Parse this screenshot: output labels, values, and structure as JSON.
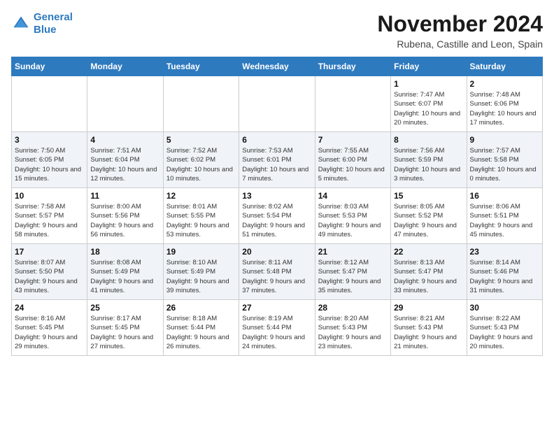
{
  "header": {
    "logo_line1": "General",
    "logo_line2": "Blue",
    "month": "November 2024",
    "location": "Rubena, Castille and Leon, Spain"
  },
  "weekdays": [
    "Sunday",
    "Monday",
    "Tuesday",
    "Wednesday",
    "Thursday",
    "Friday",
    "Saturday"
  ],
  "weeks": [
    [
      {
        "day": "",
        "info": ""
      },
      {
        "day": "",
        "info": ""
      },
      {
        "day": "",
        "info": ""
      },
      {
        "day": "",
        "info": ""
      },
      {
        "day": "",
        "info": ""
      },
      {
        "day": "1",
        "info": "Sunrise: 7:47 AM\nSunset: 6:07 PM\nDaylight: 10 hours\nand 20 minutes."
      },
      {
        "day": "2",
        "info": "Sunrise: 7:48 AM\nSunset: 6:06 PM\nDaylight: 10 hours\nand 17 minutes."
      }
    ],
    [
      {
        "day": "3",
        "info": "Sunrise: 7:50 AM\nSunset: 6:05 PM\nDaylight: 10 hours\nand 15 minutes."
      },
      {
        "day": "4",
        "info": "Sunrise: 7:51 AM\nSunset: 6:04 PM\nDaylight: 10 hours\nand 12 minutes."
      },
      {
        "day": "5",
        "info": "Sunrise: 7:52 AM\nSunset: 6:02 PM\nDaylight: 10 hours\nand 10 minutes."
      },
      {
        "day": "6",
        "info": "Sunrise: 7:53 AM\nSunset: 6:01 PM\nDaylight: 10 hours\nand 7 minutes."
      },
      {
        "day": "7",
        "info": "Sunrise: 7:55 AM\nSunset: 6:00 PM\nDaylight: 10 hours\nand 5 minutes."
      },
      {
        "day": "8",
        "info": "Sunrise: 7:56 AM\nSunset: 5:59 PM\nDaylight: 10 hours\nand 3 minutes."
      },
      {
        "day": "9",
        "info": "Sunrise: 7:57 AM\nSunset: 5:58 PM\nDaylight: 10 hours\nand 0 minutes."
      }
    ],
    [
      {
        "day": "10",
        "info": "Sunrise: 7:58 AM\nSunset: 5:57 PM\nDaylight: 9 hours\nand 58 minutes."
      },
      {
        "day": "11",
        "info": "Sunrise: 8:00 AM\nSunset: 5:56 PM\nDaylight: 9 hours\nand 56 minutes."
      },
      {
        "day": "12",
        "info": "Sunrise: 8:01 AM\nSunset: 5:55 PM\nDaylight: 9 hours\nand 53 minutes."
      },
      {
        "day": "13",
        "info": "Sunrise: 8:02 AM\nSunset: 5:54 PM\nDaylight: 9 hours\nand 51 minutes."
      },
      {
        "day": "14",
        "info": "Sunrise: 8:03 AM\nSunset: 5:53 PM\nDaylight: 9 hours\nand 49 minutes."
      },
      {
        "day": "15",
        "info": "Sunrise: 8:05 AM\nSunset: 5:52 PM\nDaylight: 9 hours\nand 47 minutes."
      },
      {
        "day": "16",
        "info": "Sunrise: 8:06 AM\nSunset: 5:51 PM\nDaylight: 9 hours\nand 45 minutes."
      }
    ],
    [
      {
        "day": "17",
        "info": "Sunrise: 8:07 AM\nSunset: 5:50 PM\nDaylight: 9 hours\nand 43 minutes."
      },
      {
        "day": "18",
        "info": "Sunrise: 8:08 AM\nSunset: 5:49 PM\nDaylight: 9 hours\nand 41 minutes."
      },
      {
        "day": "19",
        "info": "Sunrise: 8:10 AM\nSunset: 5:49 PM\nDaylight: 9 hours\nand 39 minutes."
      },
      {
        "day": "20",
        "info": "Sunrise: 8:11 AM\nSunset: 5:48 PM\nDaylight: 9 hours\nand 37 minutes."
      },
      {
        "day": "21",
        "info": "Sunrise: 8:12 AM\nSunset: 5:47 PM\nDaylight: 9 hours\nand 35 minutes."
      },
      {
        "day": "22",
        "info": "Sunrise: 8:13 AM\nSunset: 5:47 PM\nDaylight: 9 hours\nand 33 minutes."
      },
      {
        "day": "23",
        "info": "Sunrise: 8:14 AM\nSunset: 5:46 PM\nDaylight: 9 hours\nand 31 minutes."
      }
    ],
    [
      {
        "day": "24",
        "info": "Sunrise: 8:16 AM\nSunset: 5:45 PM\nDaylight: 9 hours\nand 29 minutes."
      },
      {
        "day": "25",
        "info": "Sunrise: 8:17 AM\nSunset: 5:45 PM\nDaylight: 9 hours\nand 27 minutes."
      },
      {
        "day": "26",
        "info": "Sunrise: 8:18 AM\nSunset: 5:44 PM\nDaylight: 9 hours\nand 26 minutes."
      },
      {
        "day": "27",
        "info": "Sunrise: 8:19 AM\nSunset: 5:44 PM\nDaylight: 9 hours\nand 24 minutes."
      },
      {
        "day": "28",
        "info": "Sunrise: 8:20 AM\nSunset: 5:43 PM\nDaylight: 9 hours\nand 23 minutes."
      },
      {
        "day": "29",
        "info": "Sunrise: 8:21 AM\nSunset: 5:43 PM\nDaylight: 9 hours\nand 21 minutes."
      },
      {
        "day": "30",
        "info": "Sunrise: 8:22 AM\nSunset: 5:43 PM\nDaylight: 9 hours\nand 20 minutes."
      }
    ]
  ]
}
